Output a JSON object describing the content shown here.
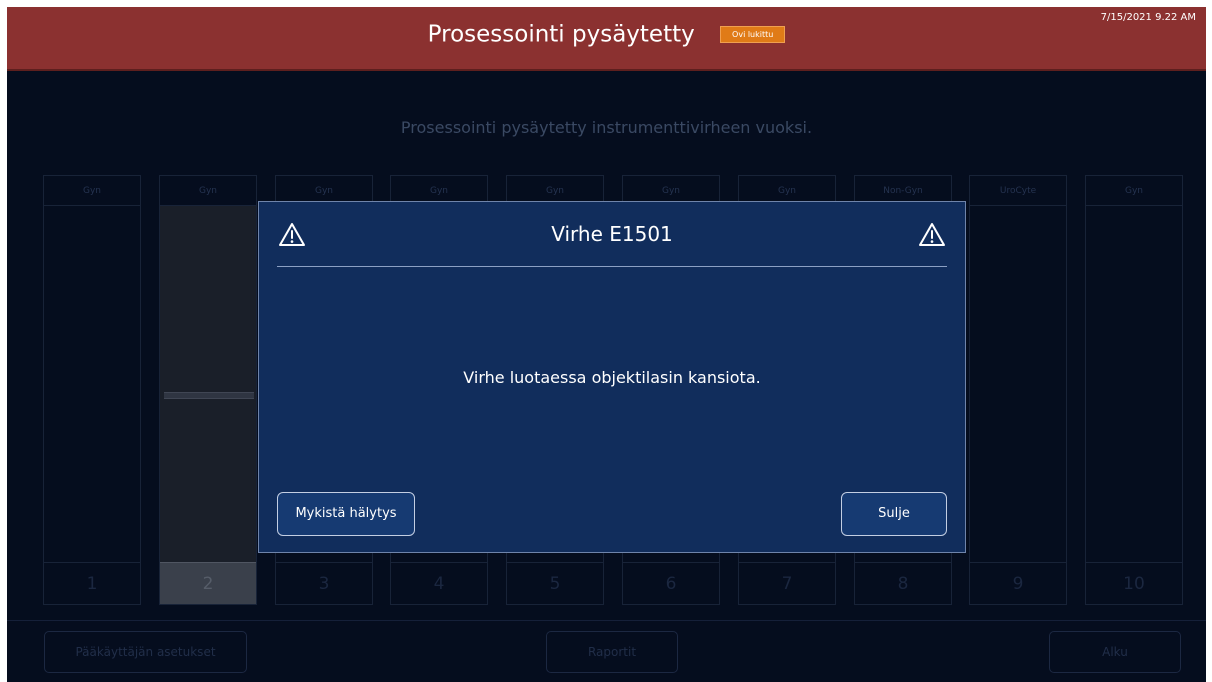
{
  "header": {
    "title": "Prosessointi pysäytetty",
    "door_badge": "Ovi lukittu",
    "clock": "7/15/2021 9.22 AM",
    "background_color": "#8b3130",
    "badge_color": "#e07b17"
  },
  "subtitle": "Prosessointi pysäytetty instrumenttivirheen vuoksi.",
  "slots": [
    {
      "label": "Gyn",
      "number": "1"
    },
    {
      "label": "Gyn",
      "number": "2"
    },
    {
      "label": "Gyn",
      "number": "3"
    },
    {
      "label": "Gyn",
      "number": "4"
    },
    {
      "label": "Gyn",
      "number": "5"
    },
    {
      "label": "Gyn",
      "number": "6"
    },
    {
      "label": "Gyn",
      "number": "7"
    },
    {
      "label": "Non-Gyn",
      "number": "8"
    },
    {
      "label": "UroCyte",
      "number": "9"
    },
    {
      "label": "Gyn",
      "number": "10"
    }
  ],
  "active_slot": "2",
  "footer": {
    "admin_settings": "Pääkäyttäjän asetukset",
    "reports": "Raportit",
    "home": "Alku"
  },
  "dialog": {
    "icon": "warning-triangle-icon",
    "title": "Virhe E1501",
    "message": "Virhe luotaessa objektilasin kansiota.",
    "mute_label": "Mykistä hälytys",
    "close_label": "Sulje",
    "background_color": "#112d5c"
  }
}
